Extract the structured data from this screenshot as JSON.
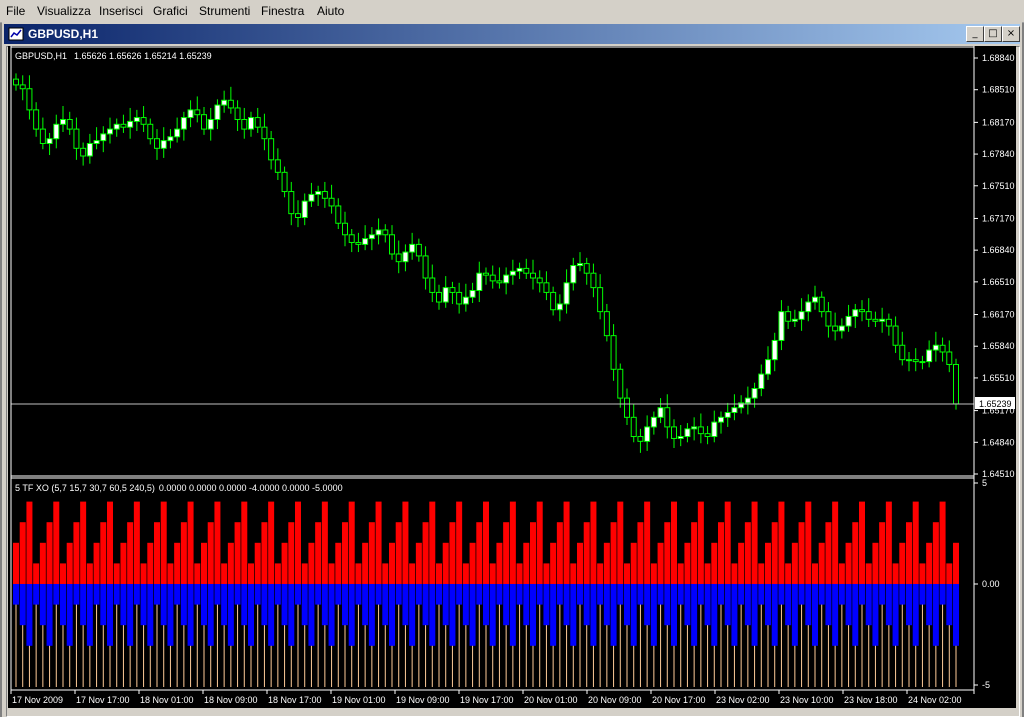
{
  "menu": {
    "items": [
      {
        "label": "File"
      },
      {
        "label": "Visualizza"
      },
      {
        "label": "Inserisci"
      },
      {
        "label": "Grafici"
      },
      {
        "label": "Strumenti"
      },
      {
        "label": "Finestra"
      },
      {
        "label": "Aiuto"
      }
    ]
  },
  "window": {
    "title": "GBPUSD,H1",
    "minimize_glyph": "_",
    "maximize_glyph": "□",
    "close_glyph": "×"
  },
  "colors": {
    "background": "#000000",
    "candle_up_body": "#ffffff",
    "candle_outline": "#00ff00",
    "hist_red": "#ff0000",
    "hist_blue": "#0000ff",
    "hist_line": "#ffcc99",
    "hist_orange": "#ff8000",
    "grid_text": "#ffffff",
    "price_line": "#c0c0c0"
  },
  "chart_data": {
    "type": "candlestick",
    "symbol_label": "GBPUSD,H1",
    "ohlc_label": "1.65626 1.65626 1.65214 1.65239",
    "current_price": "1.65239",
    "price_axis": {
      "ticks": [
        "1.68840",
        "1.68510",
        "1.68170",
        "1.67840",
        "1.67510",
        "1.67170",
        "1.66840",
        "1.66510",
        "1.66170",
        "1.65840",
        "1.65510",
        "1.65170",
        "1.64840",
        "1.64510"
      ],
      "range": [
        1.6451,
        1.6884
      ]
    },
    "time_axis": {
      "labels": [
        "17 Nov 2009",
        "17 Nov 17:00",
        "18 Nov 01:00",
        "18 Nov 09:00",
        "18 Nov 17:00",
        "19 Nov 01:00",
        "19 Nov 09:00",
        "19 Nov 17:00",
        "20 Nov 01:00",
        "20 Nov 09:00",
        "20 Nov 17:00",
        "23 Nov 02:00",
        "23 Nov 10:00",
        "23 Nov 18:00",
        "24 Nov 02:00"
      ]
    },
    "close_path": [
      1.6856,
      1.6852,
      1.683,
      1.681,
      1.6795,
      1.68,
      1.6815,
      1.682,
      1.681,
      1.679,
      1.6782,
      1.6795,
      1.6798,
      1.6805,
      1.681,
      1.6815,
      1.6812,
      1.6818,
      1.6822,
      1.6815,
      1.68,
      1.679,
      1.6798,
      1.6802,
      1.681,
      1.6822,
      1.683,
      1.6825,
      1.681,
      1.682,
      1.6835,
      1.684,
      1.6832,
      1.682,
      1.681,
      1.6822,
      1.6812,
      1.68,
      1.6778,
      1.6765,
      1.6745,
      1.6722,
      1.6718,
      1.6735,
      1.6742,
      1.6745,
      1.6738,
      1.673,
      1.6712,
      1.67,
      1.6692,
      1.669,
      1.6696,
      1.67,
      1.6705,
      1.67,
      1.668,
      1.6672,
      1.6682,
      1.669,
      1.6678,
      1.6655,
      1.664,
      1.663,
      1.6645,
      1.664,
      1.6628,
      1.6635,
      1.6642,
      1.666,
      1.6658,
      1.6652,
      1.665,
      1.6658,
      1.6662,
      1.6665,
      1.666,
      1.6655,
      1.665,
      1.664,
      1.6622,
      1.6628,
      1.665,
      1.6668,
      1.667,
      1.666,
      1.6645,
      1.662,
      1.6595,
      1.656,
      1.653,
      1.651,
      1.649,
      1.6485,
      1.65,
      1.651,
      1.652,
      1.65,
      1.6488,
      1.649,
      1.6498,
      1.65,
      1.6493,
      1.649,
      1.6505,
      1.651,
      1.6515,
      1.652,
      1.6525,
      1.653,
      1.654,
      1.6555,
      1.657,
      1.659,
      1.662,
      1.661,
      1.6612,
      1.662,
      1.663,
      1.6635,
      1.662,
      1.6605,
      1.66,
      1.6605,
      1.6615,
      1.6622,
      1.662,
      1.6612,
      1.661,
      1.6612,
      1.6605,
      1.6585,
      1.657,
      1.657,
      1.6568,
      1.6568,
      1.658,
      1.6585,
      1.6578,
      1.6565,
      1.6524
    ],
    "indicator": {
      "label": "5 TF XO (5,7 15,7 30,7 60,5 240,5)",
      "values_label": "0.0000 0.0000 0.0000 -4.0000 0.0000 -5.0000",
      "axis_ticks": [
        "5",
        "0.00",
        "-5"
      ],
      "range": [
        -5,
        5
      ]
    }
  }
}
